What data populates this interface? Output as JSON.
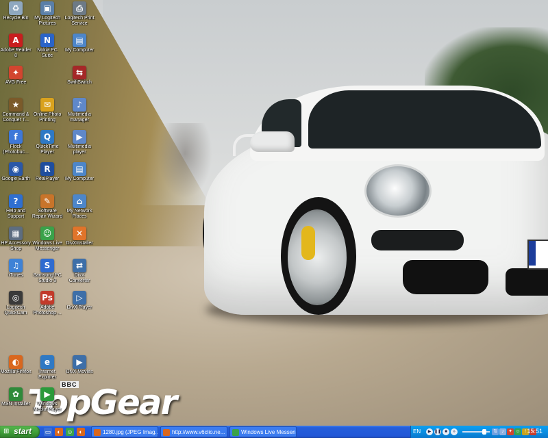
{
  "desktop": {
    "icons": [
      {
        "label": "Recycle Bin",
        "icon": "recycle-bin-icon",
        "color": "#8fa8c0",
        "glyph": "♻"
      },
      {
        "label": "My Logitech Pictures",
        "icon": "pictures-icon",
        "color": "#5a7fa8",
        "glyph": "▣"
      },
      {
        "label": "Logitech Print Service",
        "icon": "printer-icon",
        "color": "#6d7a86",
        "glyph": "⎙"
      },
      {
        "label": "Adobe Reader 8",
        "icon": "adobe-reader-icon",
        "color": "#c81e1e",
        "glyph": "A"
      },
      {
        "label": "Nokia PC Suite",
        "icon": "nokia-icon",
        "color": "#2a64c8",
        "glyph": "N"
      },
      {
        "label": "My Computer",
        "icon": "my-computer-icon",
        "color": "#4d86c9",
        "glyph": "▤"
      },
      {
        "label": "AVG Free",
        "icon": "avg-icon",
        "color": "#d2452f",
        "glyph": "✦"
      },
      {
        "label": "SwiftSwitch",
        "icon": "swiftswitch-icon",
        "color": "#a52828",
        "glyph": "⇆"
      },
      {
        "label": "Command & Conquer T...",
        "icon": "game-icon",
        "color": "#7b5a2a",
        "glyph": "★"
      },
      {
        "label": "Online Photo Printing",
        "icon": "photo-printing-icon",
        "color": "#d9a21e",
        "glyph": "✉"
      },
      {
        "label": "Multimedia manager",
        "icon": "multimedia-icon",
        "color": "#5f88c9",
        "glyph": "♪"
      },
      {
        "label": "Flock (Photobuc...",
        "icon": "flock-icon",
        "color": "#3e78d8",
        "glyph": "f"
      },
      {
        "label": "QuickTime Player",
        "icon": "quicktime-icon",
        "color": "#2f79c4",
        "glyph": "Q"
      },
      {
        "label": "Multimedia player",
        "icon": "media-player-icon",
        "color": "#5f88c9",
        "glyph": "▶"
      },
      {
        "label": "Google Earth",
        "icon": "google-earth-icon",
        "color": "#2a58a8",
        "glyph": "◉"
      },
      {
        "label": "RealPlayer",
        "icon": "realplayer-icon",
        "color": "#1f4e9e",
        "glyph": "R"
      },
      {
        "label": "My Computer",
        "icon": "my-computer-icon",
        "color": "#4d86c9",
        "glyph": "▤"
      },
      {
        "label": "Help and Support",
        "icon": "help-icon",
        "color": "#2f6fd0",
        "glyph": "?"
      },
      {
        "label": "Software Repair Wizard",
        "icon": "repair-wizard-icon",
        "color": "#c8742a",
        "glyph": "✎"
      },
      {
        "label": "My Network Places",
        "icon": "network-icon",
        "color": "#4d86c9",
        "glyph": "⌂"
      },
      {
        "label": "HP Accessory Shop",
        "icon": "hp-shop-icon",
        "color": "#5d6d80",
        "glyph": "▦"
      },
      {
        "label": "Windows Live Messenger",
        "icon": "messenger-icon",
        "color": "#3aa24a",
        "glyph": "☺"
      },
      {
        "label": "DivXInstaller",
        "icon": "divx-installer-icon",
        "color": "#e0742a",
        "glyph": "✕"
      },
      {
        "label": "iTunes",
        "icon": "itunes-icon",
        "color": "#3e82d6",
        "glyph": "♫"
      },
      {
        "label": "Samsung PC Studio 3",
        "icon": "samsung-icon",
        "color": "#2f6bd0",
        "glyph": "S"
      },
      {
        "label": "DivX Converter",
        "icon": "divx-converter-icon",
        "color": "#3e6fa8",
        "glyph": "⇄"
      },
      {
        "label": "Logitech QuickCam",
        "icon": "webcam-icon",
        "color": "#3a3a3a",
        "glyph": "◎"
      },
      {
        "label": "Adobe Photoshop ...",
        "icon": "photoshop-icon",
        "color": "#c23a2a",
        "glyph": "Ps"
      },
      {
        "label": "DivX Player",
        "icon": "divx-player-icon",
        "color": "#3e6fa8",
        "glyph": "▷"
      },
      {
        "label": "Mozilla Firefox",
        "icon": "firefox-icon",
        "color": "#d9671e",
        "glyph": "◐"
      },
      {
        "label": "Internet Explorer",
        "icon": "internet-explorer-icon",
        "color": "#2f79c4",
        "glyph": "e"
      },
      {
        "label": "DivX Movies",
        "icon": "divx-movies-icon",
        "color": "#3e6fa8",
        "glyph": "▶"
      },
      {
        "label": "MSN Installer",
        "icon": "msn-icon",
        "color": "#2f8a3a",
        "glyph": "✿"
      },
      {
        "label": "Windows Media Player",
        "icon": "wmp-icon",
        "color": "#2b9a3b",
        "glyph": "▶"
      }
    ]
  },
  "wallpaper": {
    "logo_text": "TopGear",
    "logo_badge": "BBC"
  },
  "taskbar": {
    "start_label": "start",
    "quick_launch": [
      {
        "icon": "show-desktop-icon",
        "color": "#3d6fd2",
        "glyph": "▭"
      },
      {
        "icon": "firefox-icon",
        "color": "#d9671e",
        "glyph": "◐"
      },
      {
        "icon": "messenger-icon",
        "color": "#3aa24a",
        "glyph": "☺"
      },
      {
        "icon": "firefox-icon",
        "color": "#d9671e",
        "glyph": "◐"
      }
    ],
    "tasks": [
      {
        "label": "1280.jpg (JPEG Imag...",
        "icon": "firefox-icon",
        "color": "#d9671e"
      },
      {
        "label": "http://www.v6clio.ne...",
        "icon": "firefox-icon",
        "color": "#d9671e"
      },
      {
        "label": "Windows Live Messen...",
        "icon": "messenger-icon",
        "color": "#3aa24a"
      }
    ],
    "tray": {
      "language": "EN",
      "tray_icons": [
        {
          "icon": "network-icon",
          "color": "#6fa0e0",
          "glyph": "⇅"
        },
        {
          "icon": "volume-icon",
          "color": "#8fb0e0",
          "glyph": "♪"
        },
        {
          "icon": "antivirus-icon",
          "color": "#d2452f",
          "glyph": "✦"
        },
        {
          "icon": "messenger-icon",
          "color": "#3aa24a",
          "glyph": "☺"
        },
        {
          "icon": "security-icon",
          "color": "#c8a21e",
          "glyph": "!"
        },
        {
          "icon": "flag-icon",
          "color": "#c83a2a",
          "glyph": "▪"
        }
      ],
      "clock": "15:51"
    }
  }
}
